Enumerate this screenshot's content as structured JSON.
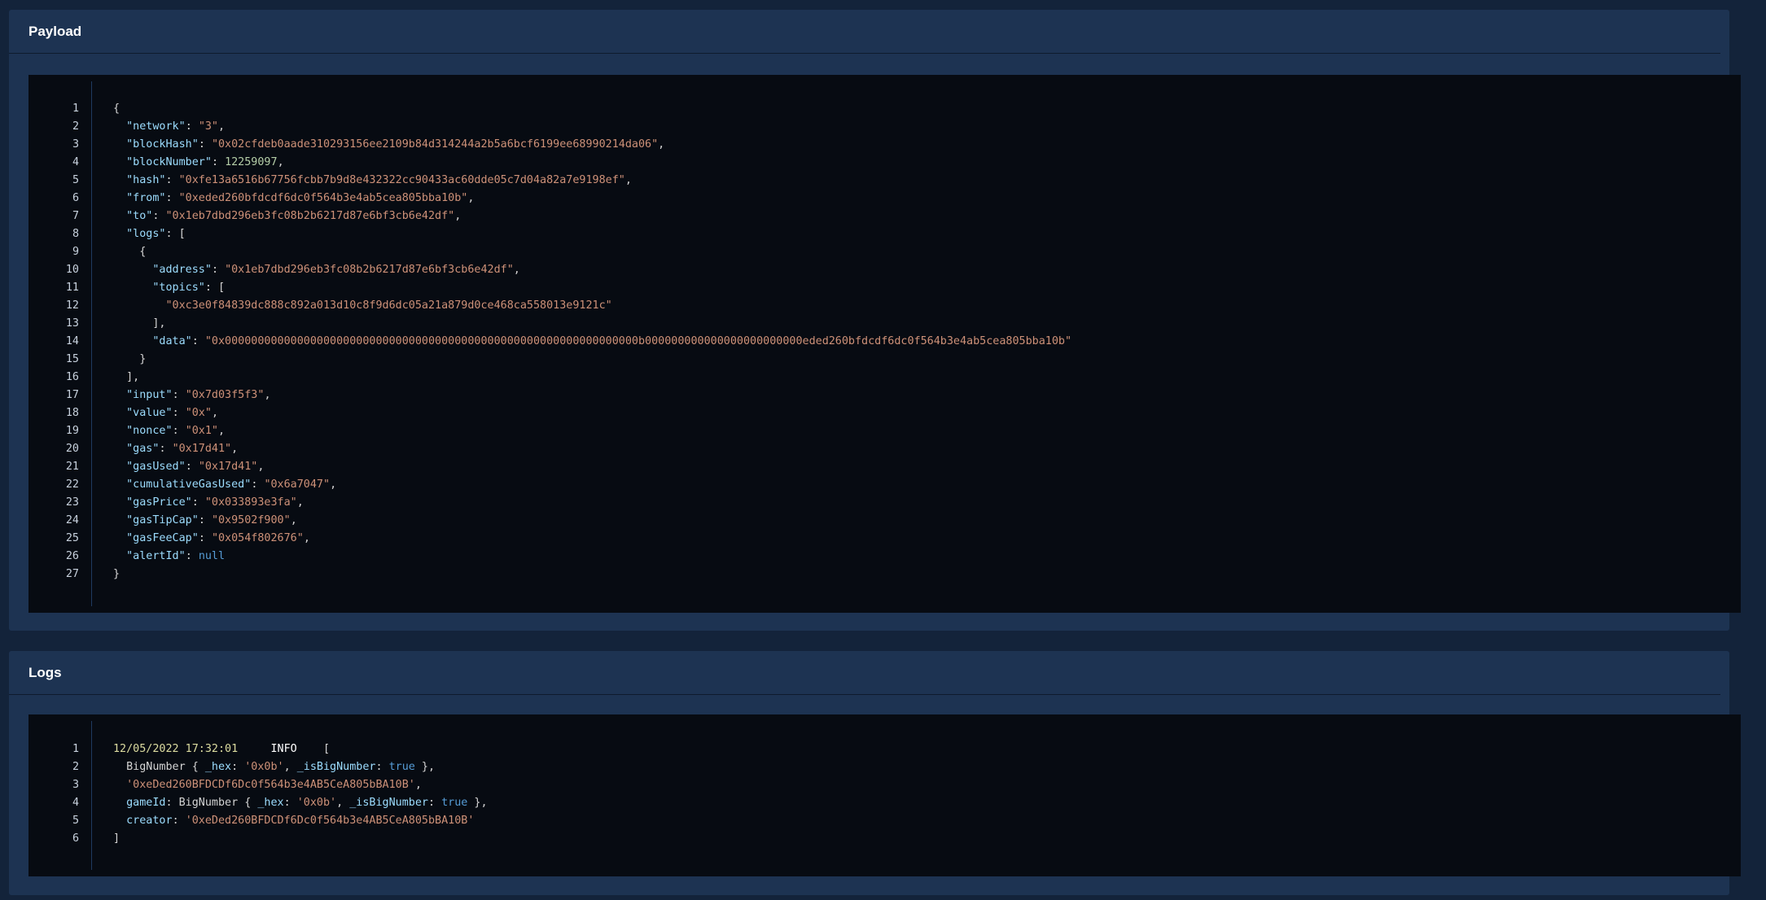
{
  "payload": {
    "title": "Payload",
    "lines": [
      [
        [
          "p",
          "{"
        ]
      ],
      [
        [
          "p",
          "  "
        ],
        [
          "k",
          "\"network\""
        ],
        [
          "p",
          ": "
        ],
        [
          "s",
          "\"3\""
        ],
        [
          "p",
          ","
        ]
      ],
      [
        [
          "p",
          "  "
        ],
        [
          "k",
          "\"blockHash\""
        ],
        [
          "p",
          ": "
        ],
        [
          "s",
          "\"0x02cfdeb0aade310293156ee2109b84d314244a2b5a6bcf6199ee68990214da06\""
        ],
        [
          "p",
          ","
        ]
      ],
      [
        [
          "p",
          "  "
        ],
        [
          "k",
          "\"blockNumber\""
        ],
        [
          "p",
          ": "
        ],
        [
          "n",
          "12259097"
        ],
        [
          "p",
          ","
        ]
      ],
      [
        [
          "p",
          "  "
        ],
        [
          "k",
          "\"hash\""
        ],
        [
          "p",
          ": "
        ],
        [
          "s",
          "\"0xfe13a6516b67756fcbb7b9d8e432322cc90433ac60dde05c7d04a82a7e9198ef\""
        ],
        [
          "p",
          ","
        ]
      ],
      [
        [
          "p",
          "  "
        ],
        [
          "k",
          "\"from\""
        ],
        [
          "p",
          ": "
        ],
        [
          "s",
          "\"0xeded260bfdcdf6dc0f564b3e4ab5cea805bba10b\""
        ],
        [
          "p",
          ","
        ]
      ],
      [
        [
          "p",
          "  "
        ],
        [
          "k",
          "\"to\""
        ],
        [
          "p",
          ": "
        ],
        [
          "s",
          "\"0x1eb7dbd296eb3fc08b2b6217d87e6bf3cb6e42df\""
        ],
        [
          "p",
          ","
        ]
      ],
      [
        [
          "p",
          "  "
        ],
        [
          "k",
          "\"logs\""
        ],
        [
          "p",
          ": ["
        ]
      ],
      [
        [
          "p",
          "    {"
        ]
      ],
      [
        [
          "p",
          "      "
        ],
        [
          "k",
          "\"address\""
        ],
        [
          "p",
          ": "
        ],
        [
          "s",
          "\"0x1eb7dbd296eb3fc08b2b6217d87e6bf3cb6e42df\""
        ],
        [
          "p",
          ","
        ]
      ],
      [
        [
          "p",
          "      "
        ],
        [
          "k",
          "\"topics\""
        ],
        [
          "p",
          ": ["
        ]
      ],
      [
        [
          "p",
          "        "
        ],
        [
          "s",
          "\"0xc3e0f84839dc888c892a013d10c8f9d6dc05a21a879d0ce468ca558013e9121c\""
        ]
      ],
      [
        [
          "p",
          "      ],"
        ]
      ],
      [
        [
          "p",
          "      "
        ],
        [
          "k",
          "\"data\""
        ],
        [
          "p",
          ": "
        ],
        [
          "s",
          "\"0x000000000000000000000000000000000000000000000000000000000000000b000000000000000000000000eded260bfdcdf6dc0f564b3e4ab5cea805bba10b\""
        ]
      ],
      [
        [
          "p",
          "    }"
        ]
      ],
      [
        [
          "p",
          "  ],"
        ]
      ],
      [
        [
          "p",
          "  "
        ],
        [
          "k",
          "\"input\""
        ],
        [
          "p",
          ": "
        ],
        [
          "s",
          "\"0x7d03f5f3\""
        ],
        [
          "p",
          ","
        ]
      ],
      [
        [
          "p",
          "  "
        ],
        [
          "k",
          "\"value\""
        ],
        [
          "p",
          ": "
        ],
        [
          "s",
          "\"0x\""
        ],
        [
          "p",
          ","
        ]
      ],
      [
        [
          "p",
          "  "
        ],
        [
          "k",
          "\"nonce\""
        ],
        [
          "p",
          ": "
        ],
        [
          "s",
          "\"0x1\""
        ],
        [
          "p",
          ","
        ]
      ],
      [
        [
          "p",
          "  "
        ],
        [
          "k",
          "\"gas\""
        ],
        [
          "p",
          ": "
        ],
        [
          "s",
          "\"0x17d41\""
        ],
        [
          "p",
          ","
        ]
      ],
      [
        [
          "p",
          "  "
        ],
        [
          "k",
          "\"gasUsed\""
        ],
        [
          "p",
          ": "
        ],
        [
          "s",
          "\"0x17d41\""
        ],
        [
          "p",
          ","
        ]
      ],
      [
        [
          "p",
          "  "
        ],
        [
          "k",
          "\"cumulativeGasUsed\""
        ],
        [
          "p",
          ": "
        ],
        [
          "s",
          "\"0x6a7047\""
        ],
        [
          "p",
          ","
        ]
      ],
      [
        [
          "p",
          "  "
        ],
        [
          "k",
          "\"gasPrice\""
        ],
        [
          "p",
          ": "
        ],
        [
          "s",
          "\"0x033893e3fa\""
        ],
        [
          "p",
          ","
        ]
      ],
      [
        [
          "p",
          "  "
        ],
        [
          "k",
          "\"gasTipCap\""
        ],
        [
          "p",
          ": "
        ],
        [
          "s",
          "\"0x9502f900\""
        ],
        [
          "p",
          ","
        ]
      ],
      [
        [
          "p",
          "  "
        ],
        [
          "k",
          "\"gasFeeCap\""
        ],
        [
          "p",
          ": "
        ],
        [
          "s",
          "\"0x054f802676\""
        ],
        [
          "p",
          ","
        ]
      ],
      [
        [
          "p",
          "  "
        ],
        [
          "k",
          "\"alertId\""
        ],
        [
          "p",
          ": "
        ],
        [
          "kw",
          "null"
        ]
      ],
      [
        [
          "p",
          "}"
        ]
      ]
    ]
  },
  "logs": {
    "title": "Logs",
    "lines": [
      [
        [
          "d",
          "12/05/2022 17:32:01"
        ],
        [
          "p",
          "     "
        ],
        [
          "info",
          "INFO"
        ],
        [
          "p",
          "    ["
        ]
      ],
      [
        [
          "p",
          "  BigNumber { "
        ],
        [
          "k",
          "_hex"
        ],
        [
          "p",
          ": "
        ],
        [
          "s",
          "'0x0b'"
        ],
        [
          "p",
          ", "
        ],
        [
          "k",
          "_isBigNumber"
        ],
        [
          "p",
          ": "
        ],
        [
          "kw",
          "true"
        ],
        [
          "p",
          " },"
        ]
      ],
      [
        [
          "p",
          "  "
        ],
        [
          "s",
          "'0xeDed260BFDCDf6Dc0f564b3e4AB5CeA805bBA10B'"
        ],
        [
          "p",
          ","
        ]
      ],
      [
        [
          "p",
          "  "
        ],
        [
          "k",
          "gameId"
        ],
        [
          "p",
          ": BigNumber { "
        ],
        [
          "k",
          "_hex"
        ],
        [
          "p",
          ": "
        ],
        [
          "s",
          "'0x0b'"
        ],
        [
          "p",
          ", "
        ],
        [
          "k",
          "_isBigNumber"
        ],
        [
          "p",
          ": "
        ],
        [
          "kw",
          "true"
        ],
        [
          "p",
          " },"
        ]
      ],
      [
        [
          "p",
          "  "
        ],
        [
          "k",
          "creator"
        ],
        [
          "p",
          ": "
        ],
        [
          "s",
          "'0xeDed260BFDCDf6Dc0f564b3e4AB5CeA805bBA10B'"
        ]
      ],
      [
        [
          "p",
          "]"
        ]
      ]
    ]
  },
  "colors": {
    "background": "#13233a",
    "panel": "#1d3352",
    "code_background": "#070b12",
    "key": "#9cdcfe",
    "string": "#ce9178",
    "number": "#b5cea8",
    "keyword": "#569cd6",
    "date": "#dcdca0"
  }
}
